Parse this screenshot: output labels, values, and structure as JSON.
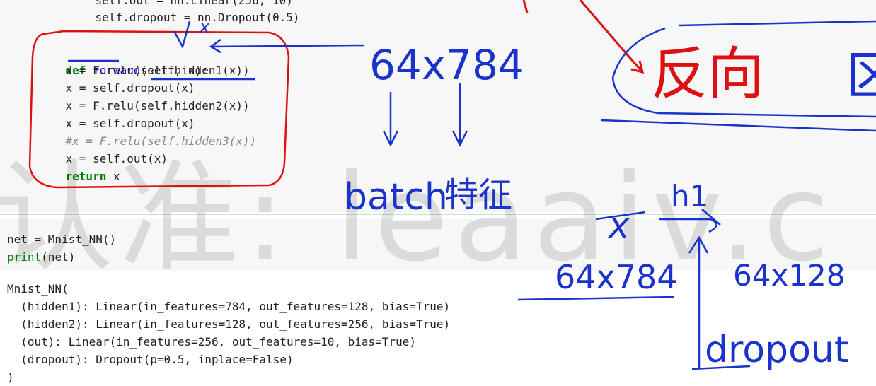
{
  "code_cell": {
    "lines": [
      "    self.out = nn.Linear(256, 10)",
      "    self.dropout = nn.Dropout(0.5)",
      "",
      "def forward(self, x):",
      "    x = F.relu(self.hidden1(x))",
      "    x = self.dropout(x)",
      "    x = F.relu(self.hidden2(x))",
      "    x = self.dropout(x)",
      "    #x = F.relu(self.hidden3(x))",
      "    x = self.out(x)",
      "    return x"
    ]
  },
  "input_cell": {
    "lines": [
      "net = Mnist_NN()",
      "print(net)"
    ]
  },
  "output": {
    "lines": [
      "Mnist_NN(",
      "  (hidden1): Linear(in_features=784, out_features=128, bias=True)",
      "  (hidden2): Linear(in_features=128, out_features=256, bias=True)",
      "  (out): Linear(in_features=256, out_features=10, bias=True)",
      "  (dropout): Dropout(p=0.5, inplace=False)",
      ")"
    ]
  },
  "watermark": "认准: leaaiv.c",
  "annotations": {
    "batch_dims_top": "64x784",
    "batch_label": "batch",
    "feature_label": "特征",
    "x_label": "x",
    "h1_label": "h1",
    "x_dims": "64x784",
    "h1_dims": "64x128",
    "dropout_label": "dropout",
    "reverse_label": "反向",
    "fragment_label": "区"
  },
  "colors": {
    "ink_blue": "#1a33cc",
    "ink_red": "#dd1111",
    "keyword": "#008000",
    "function_name": "#0000cc",
    "comment": "#8a8a8a"
  }
}
